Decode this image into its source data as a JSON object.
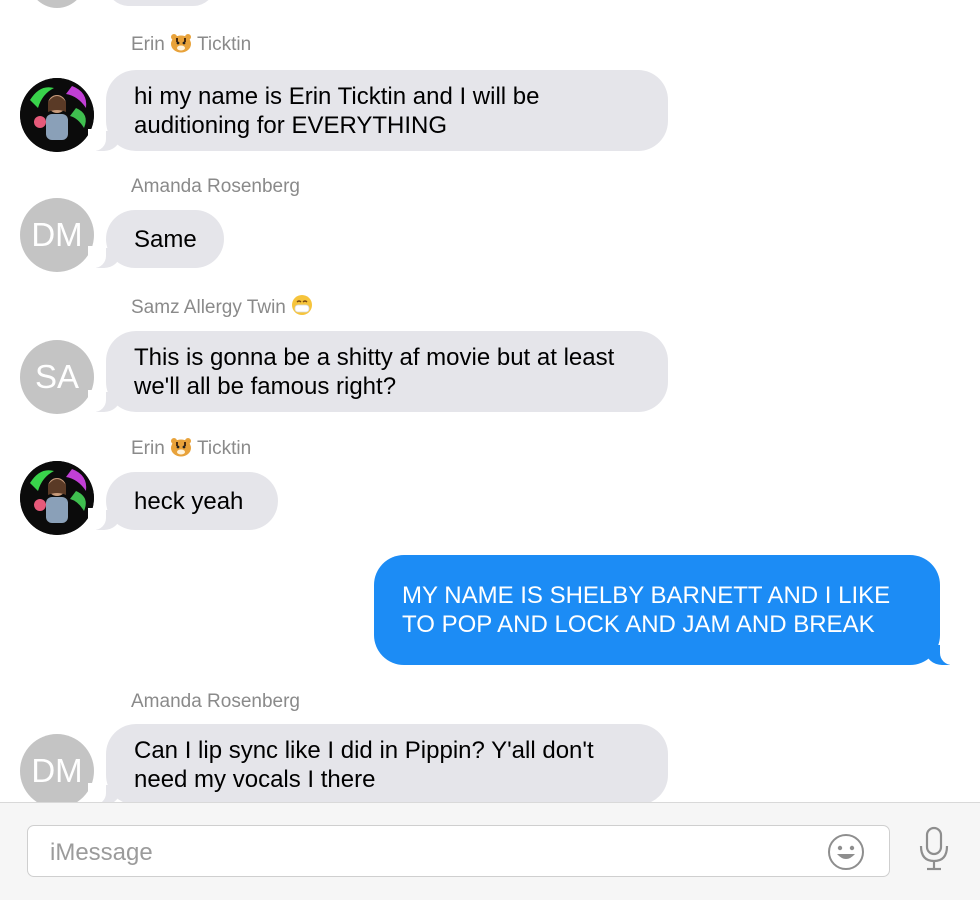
{
  "messages": [
    {
      "sender": "Erin",
      "sender_suffix": "Ticktin",
      "sender_emoji": "tiger-face-icon",
      "avatar": "photo",
      "text": "hi my name is Erin Ticktin and I will be auditioning for EVERYTHING"
    },
    {
      "sender": "Amanda Rosenberg",
      "avatar_initials": "DM",
      "text": "Same"
    },
    {
      "sender": "Samz Allergy Twin",
      "sender_emoji": "mask-face-icon",
      "avatar_initials": "SA",
      "text": "This is gonna be a shitty af movie but at least we'll all be famous right?"
    },
    {
      "sender": "Erin",
      "sender_suffix": "Ticktin",
      "sender_emoji": "tiger-face-icon",
      "avatar": "photo",
      "text": "heck yeah"
    },
    {
      "direction": "outgoing",
      "text": "MY NAME IS SHELBY BARNETT AND I LIKE TO POP AND LOCK AND JAM AND BREAK"
    },
    {
      "sender": "Amanda Rosenberg",
      "avatar_initials": "DM",
      "text": "Can I lip sync like I did in Pippin? Y'all don't need my vocals I there"
    }
  ],
  "composer": {
    "placeholder": "iMessage",
    "emoji_button_icon": "smiley-icon",
    "dictation_button_icon": "microphone-icon"
  },
  "colors": {
    "incoming_bubble": "#e5e5ea",
    "outgoing_bubble": "#1c8cf5",
    "avatar_gray": "#c4c4c4",
    "sender_text": "#8a8a8a"
  }
}
